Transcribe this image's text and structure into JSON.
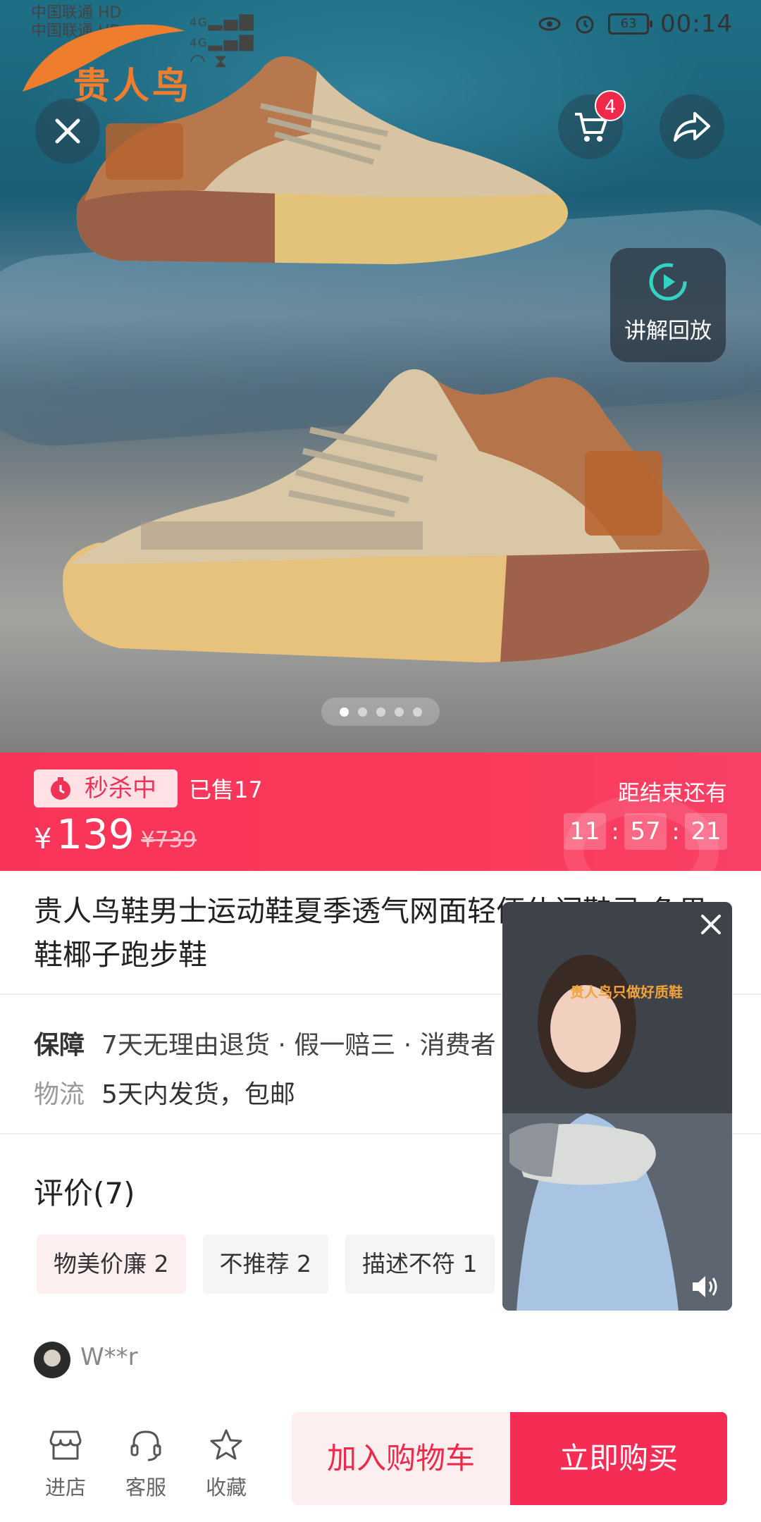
{
  "status_bar": {
    "carrier_1": "中国联通",
    "carrier_2": "中国联通",
    "hd_1": "HD",
    "hd_2": "HD",
    "net_1": "4G",
    "net_2": "4G",
    "battery": "63",
    "time": "00:14",
    "icons": [
      "eye-icon",
      "alarm-icon",
      "battery-icon",
      "wifi-icon",
      "hourglass-icon",
      "signal-icon"
    ]
  },
  "brand": {
    "name": "贵人鸟"
  },
  "top_actions": {
    "cart_count": "4",
    "icons": [
      "close-icon",
      "cart-icon",
      "share-icon"
    ]
  },
  "replay": {
    "label": "讲解回放",
    "icon": "play-icon"
  },
  "carousel": {
    "total": 5,
    "active_index": 0
  },
  "flash_sale": {
    "tag": "秒杀中",
    "sold": "已售17",
    "currency": "¥",
    "price": "139",
    "original_price": "¥739",
    "countdown_label": "距结束还有",
    "countdown": {
      "hours": "11",
      "minutes": "57",
      "seconds": "21",
      "sep": ":"
    },
    "accent": "#f9345a"
  },
  "product": {
    "title": "贵人鸟鞋男士运动鞋夏季透气网面轻便休闲鞋灵 色男鞋椰子跑步鞋"
  },
  "service": {
    "guarantee_label": "保障",
    "guarantee_value": "7天无理由退货 · 假一赔三 · 消费者",
    "logistics_label": "物流",
    "logistics_value": "5天内发货，包邮"
  },
  "reviews": {
    "title": "评价(7)",
    "tags": [
      {
        "label": "物美价廉 2"
      },
      {
        "label": "不推荐 2"
      },
      {
        "label": "描述不符 1"
      }
    ],
    "first_reviewer": "W**r"
  },
  "video": {
    "logo_text": "贵人鸟只做好质鞋",
    "icons": [
      "close-icon",
      "volume-icon"
    ]
  },
  "bottom_bar": {
    "store": "进店",
    "service": "客服",
    "favorite": "收藏",
    "add_to_cart": "加入购物车",
    "buy_now": "立即购买",
    "primary_color": "#f52d55"
  }
}
